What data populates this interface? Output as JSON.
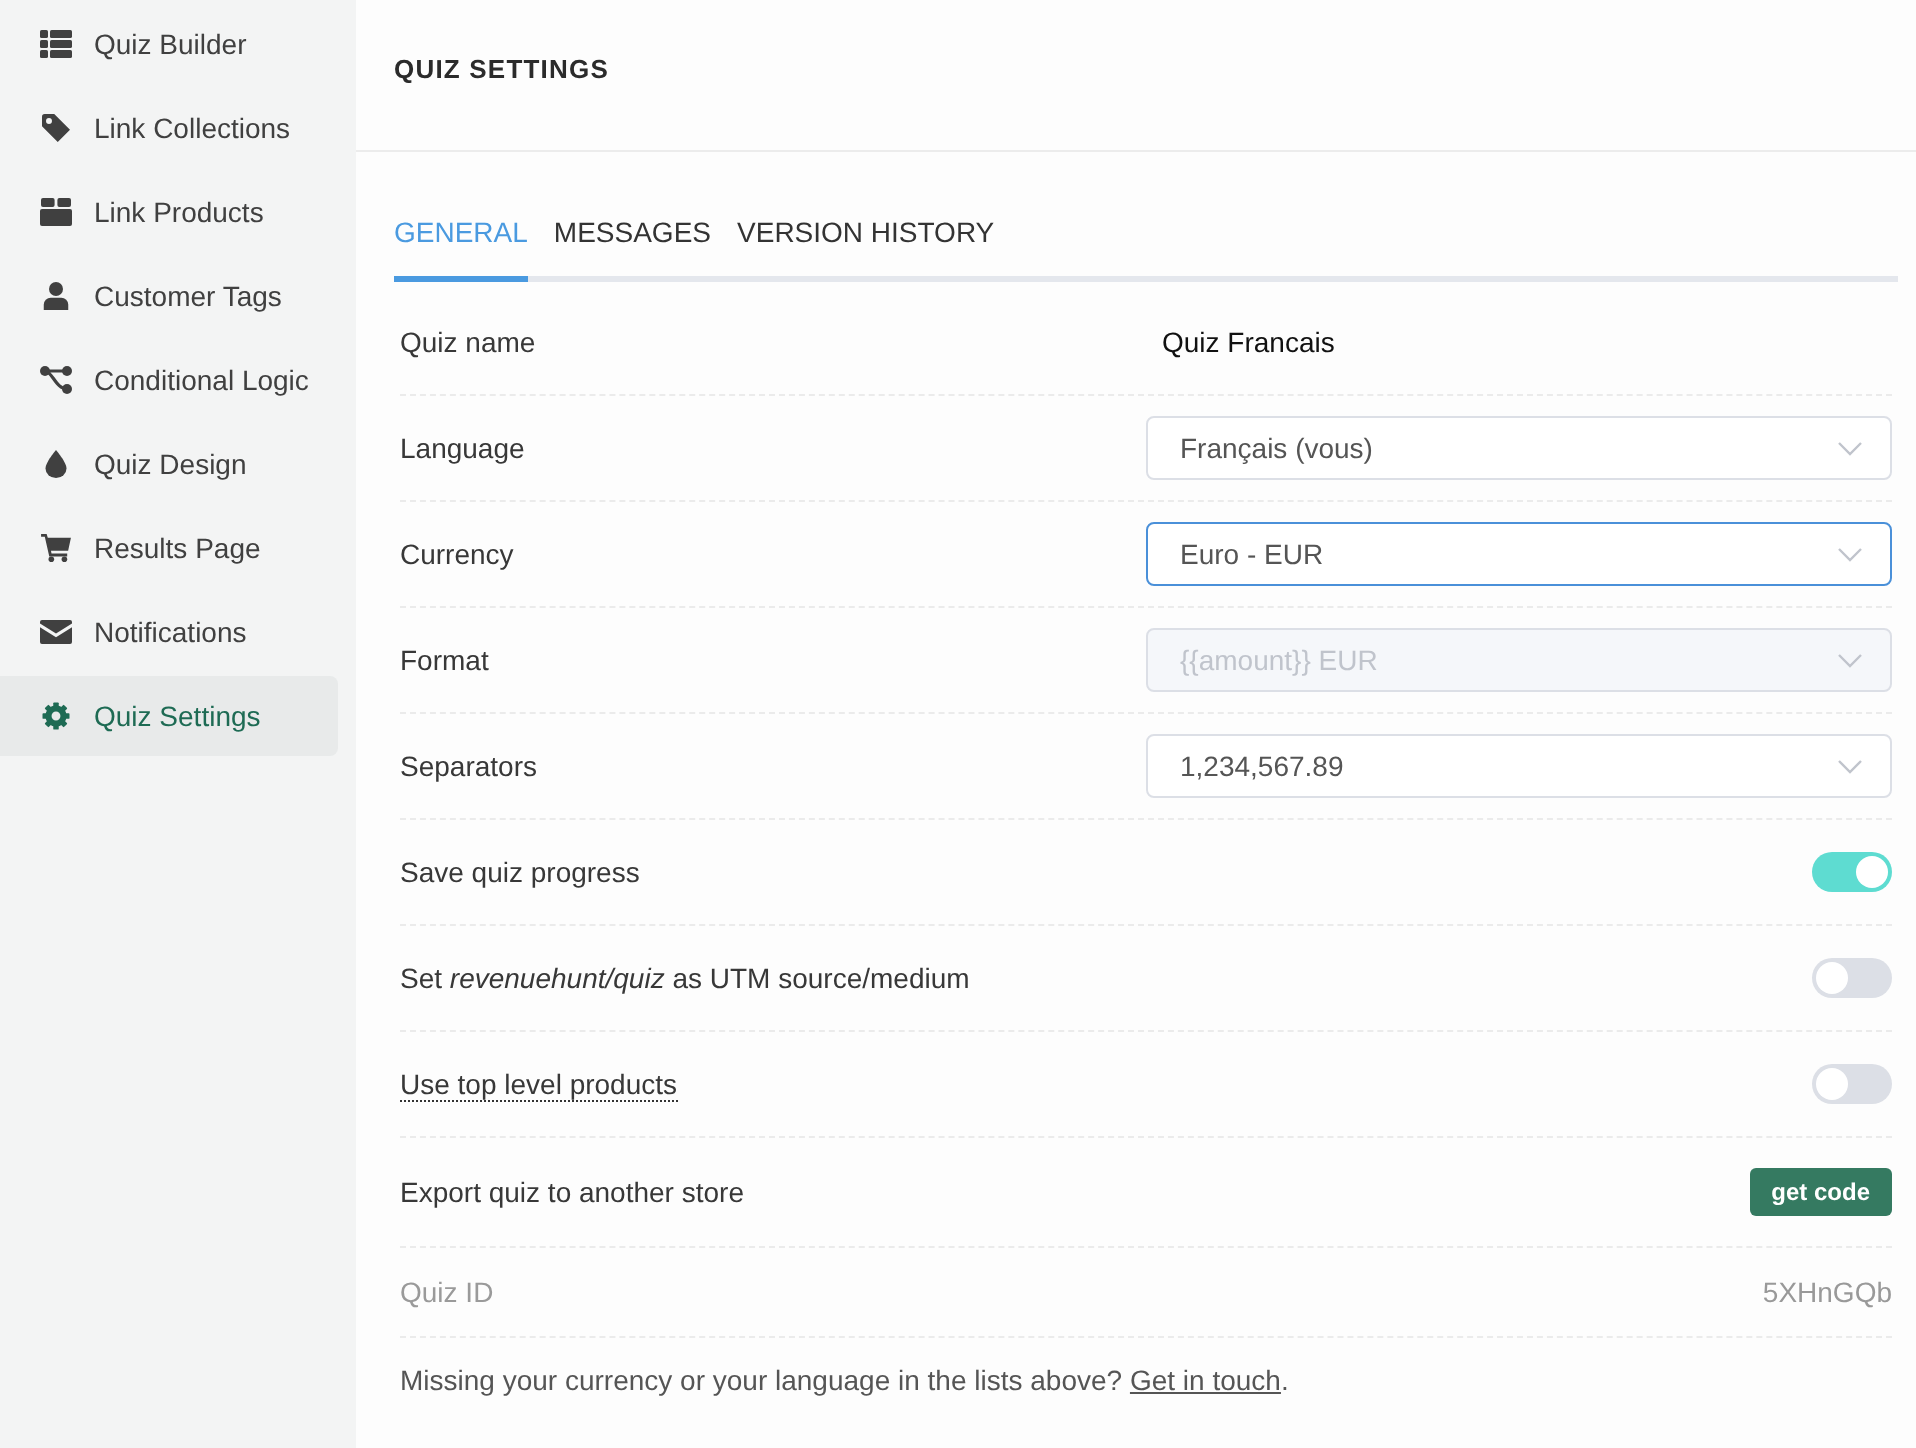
{
  "sidebar": {
    "items": [
      {
        "label": "Quiz Builder",
        "selected": false
      },
      {
        "label": "Link Collections",
        "selected": false
      },
      {
        "label": "Link Products",
        "selected": false
      },
      {
        "label": "Customer Tags",
        "selected": false
      },
      {
        "label": "Conditional Logic",
        "selected": false
      },
      {
        "label": "Quiz Design",
        "selected": false
      },
      {
        "label": "Results Page",
        "selected": false
      },
      {
        "label": "Notifications",
        "selected": false
      },
      {
        "label": "Quiz Settings",
        "selected": true
      }
    ]
  },
  "header": {
    "title": "QUIZ SETTINGS"
  },
  "tabs": [
    {
      "label": "GENERAL",
      "selected": true
    },
    {
      "label": "MESSAGES",
      "selected": false
    },
    {
      "label": "VERSION HISTORY",
      "selected": false
    }
  ],
  "settings": {
    "rows": [
      {
        "kind": "text",
        "label": "Quiz name",
        "tooltip": false,
        "value": "Quiz Francais"
      },
      {
        "kind": "select",
        "label": "Language",
        "tooltip": false,
        "value": "Français (vous)",
        "focused": false,
        "disabled": false
      },
      {
        "kind": "select",
        "label": "Currency",
        "tooltip": false,
        "value": "Euro - EUR",
        "focused": true,
        "disabled": false
      },
      {
        "kind": "select",
        "label": "Format",
        "tooltip": false,
        "value": "{{amount}} EUR",
        "focused": false,
        "disabled": true
      },
      {
        "kind": "select",
        "label": "Separators",
        "tooltip": false,
        "value": "1,234,567.89",
        "focused": false,
        "disabled": false
      },
      {
        "kind": "toggle",
        "label": "Save quiz progress",
        "tooltip": false,
        "on": true
      },
      {
        "kind": "toggle",
        "label": "Set *revenuehunt/quiz* as UTM source/medium",
        "tooltip": false,
        "on": false
      },
      {
        "kind": "toggle",
        "label": "Use top level products",
        "tooltip": true,
        "on": false
      },
      {
        "kind": "button",
        "label": "Export quiz to another store",
        "tooltip": false,
        "button": "get code"
      },
      {
        "kind": "id",
        "label": "Quiz ID",
        "tooltip": false,
        "value": "5XHnGQb"
      }
    ]
  },
  "footer": {
    "text": "Missing your currency or your language in the lists above?",
    "link": "Get in touch",
    "end": "."
  }
}
